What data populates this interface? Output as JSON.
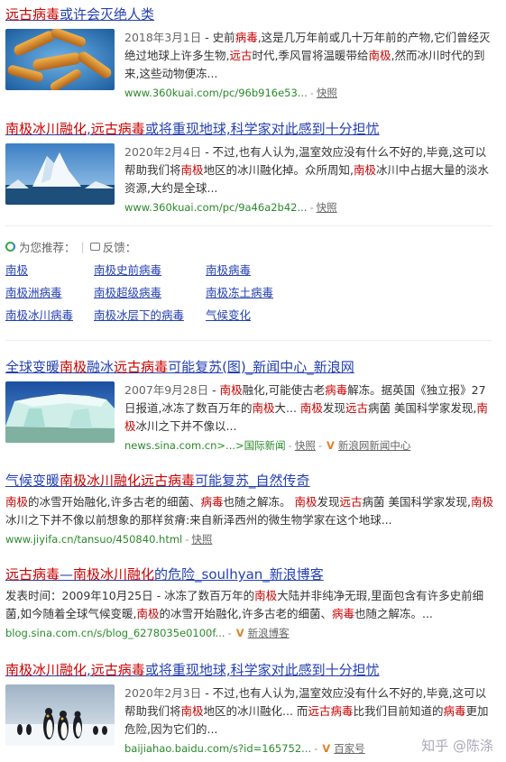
{
  "results": [
    {
      "title_parts": [
        [
          "远古病毒",
          1
        ],
        [
          "或许会灭绝人类",
          0
        ]
      ],
      "date": "2018年3月1日",
      "snippet_parts": [
        [
          " - 史前",
          0
        ],
        [
          "病毒",
          1
        ],
        [
          ",这是几万年前或几十万年前的产物,它们曾经灭绝过地球上许多生物,",
          0
        ],
        [
          "远古",
          1
        ],
        [
          "时代,季风冒将温暖带给",
          0
        ],
        [
          "南极",
          1
        ],
        [
          ",然而冰川时代的到来,这些动物便冻...",
          0
        ]
      ],
      "url": "www.360kuai.com/pc/96b916e53...",
      "snap": "快照"
    },
    {
      "title_parts": [
        [
          "南极冰川融化",
          1
        ],
        [
          ",",
          0
        ],
        [
          "远古病毒",
          1
        ],
        [
          "或将重现地球,科学家对此感到十分担忧",
          0
        ]
      ],
      "date": "2020年2月4日",
      "snippet_parts": [
        [
          " - 不过,也有人认为,温室效应没有什么不好的,毕竟,这可以帮助我们将",
          0
        ],
        [
          "南极",
          1
        ],
        [
          "地区的冰川融化掉。众所周知,",
          0
        ],
        [
          "南极",
          1
        ],
        [
          "冰川中占据大量的淡水资源,大约是全球...",
          0
        ]
      ],
      "url": "www.360kuai.com/pc/9a46a2b42...",
      "snap": "快照"
    },
    {
      "title_parts": [
        [
          "全球变暖",
          0
        ],
        [
          "南极",
          1
        ],
        [
          "融冰",
          0
        ],
        [
          "远古病毒",
          1
        ],
        [
          "可能复苏(图)_新闻中心_新浪网",
          0
        ]
      ],
      "date": "2007年9月28日",
      "snippet_parts": [
        [
          " - ",
          0
        ],
        [
          "南极",
          1
        ],
        [
          "融化,可能使古老",
          0
        ],
        [
          "病毒",
          1
        ],
        [
          "解冻。据英国《独立报》27日报道,冰冻了数百万年的",
          0
        ],
        [
          "南极",
          1
        ],
        [
          "大... ",
          0
        ],
        [
          "南极",
          1
        ],
        [
          "发现",
          0
        ],
        [
          "远古",
          1
        ],
        [
          "病菌 美国科学家发现,",
          0
        ],
        [
          "南极",
          1
        ],
        [
          "冰川之下并不像以...",
          0
        ]
      ],
      "url": "news.sina.com.cn>...>国际新闻",
      "snap": "快照",
      "source": "新浪网新闻中心"
    },
    {
      "title_parts": [
        [
          "气候变暖",
          0
        ],
        [
          "南极冰川融化",
          1
        ],
        [
          "远古病毒",
          1
        ],
        [
          "可能复苏_自然传奇",
          0
        ]
      ],
      "snippet_parts": [
        [
          "南极",
          1
        ],
        [
          "的冰雪开始融化,许多古老的细菌、",
          0
        ],
        [
          "病毒",
          1
        ],
        [
          "也随之解冻。 ",
          0
        ],
        [
          "南极",
          1
        ],
        [
          "发现",
          0
        ],
        [
          "远古",
          1
        ],
        [
          "病菌 美国科学家发现,",
          0
        ],
        [
          "南极",
          1
        ],
        [
          "冰川之下并不像以前想象的那样贫瘠:来自新泽西州的微生物学家在这个地球...",
          0
        ]
      ],
      "url": "www.jiyifa.cn/tansuo/450840.html",
      "snap": "快照"
    },
    {
      "title_parts": [
        [
          "远古病毒",
          1
        ],
        [
          "—",
          0
        ],
        [
          "南极冰川融化",
          1
        ],
        [
          "的危险_soulhyan_新浪博客",
          0
        ]
      ],
      "snippet_parts": [
        [
          "发表时间：2009年10月25日 - 冰冻了数百万年的",
          0
        ],
        [
          "南极",
          1
        ],
        [
          "大陆并非纯净无瑕,里面包含有许多史前细菌,如今随着全球气候变暖,",
          0
        ],
        [
          "南极",
          1
        ],
        [
          "的冰雪开始融化,许多古老的细菌、",
          0
        ],
        [
          "病毒",
          1
        ],
        [
          "也随之解冻。...",
          0
        ]
      ],
      "url": "blog.sina.com.cn/s/blog_6278035e0100f...",
      "source": "新浪博客"
    },
    {
      "title_parts": [
        [
          "南极冰川融化",
          1
        ],
        [
          ",",
          0
        ],
        [
          "远古病毒",
          1
        ],
        [
          "或将重现地球,科学家对此感到十分担忧",
          0
        ]
      ],
      "date": "2020年2月3日",
      "snippet_parts": [
        [
          " - 不过,也有人认为,温室效应没有什么不好的,毕竟,这可以帮助我们将",
          0
        ],
        [
          "南极",
          1
        ],
        [
          "地区的冰川融化... 而",
          0
        ],
        [
          "远古病毒",
          1
        ],
        [
          "比我们目前知道的",
          0
        ],
        [
          "病毒",
          1
        ],
        [
          "更加危险,因为它们的...",
          0
        ]
      ],
      "url": "baijiahao.baidu.com/s?id=165752...",
      "source": "百家号"
    }
  ],
  "recommend": {
    "label": "为您推荐",
    "feedback": "反馈",
    "colon": "：",
    "items": [
      "南极",
      "南极史前病毒",
      "南极病毒",
      "南极洲病毒",
      "南极超级病毒",
      "南极冻土病毒",
      "南极冰川病毒",
      "南极冰层下的病毒",
      "气候变化"
    ]
  },
  "watermark": "知乎 @陈涤"
}
